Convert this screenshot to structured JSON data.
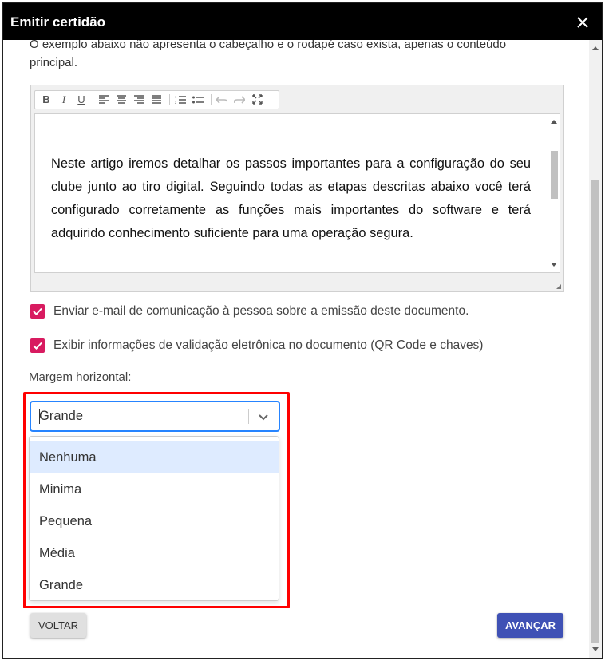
{
  "dialog": {
    "title": "Emitir certidão",
    "intro_line1": "O exemplo abaixo não apresenta o cabeçalho e o rodapé caso exista, apenas o conteúdo",
    "intro_line2": "principal."
  },
  "editor": {
    "toolbar": [
      "bold-icon",
      "italic-icon",
      "underline-icon",
      "align-left-icon",
      "align-center-icon",
      "align-right-icon",
      "align-justify-icon",
      "numbered-list-icon",
      "bullet-list-icon",
      "undo-icon",
      "redo-icon",
      "fullscreen-icon"
    ],
    "content": "Neste artigo iremos detalhar os passos importantes para a configuração do seu clube junto ao tiro digital. Seguindo todas as etapas descritas abaixo você terá configurado corretamente as funções mais importantes do software e terá adquirido conhecimento suficiente para uma operação segura."
  },
  "options": {
    "send_email": "Enviar e-mail de comunicação à pessoa sobre a emissão deste documento.",
    "show_validation": "Exibir informações de validação eletrônica no documento (QR Code e chaves)"
  },
  "margin": {
    "label": "Margem horizontal:",
    "selected": "Grande",
    "choices": [
      "Nenhuma",
      "Minima",
      "Pequena",
      "Média",
      "Grande"
    ]
  },
  "buttons": {
    "back": "VOLTAR",
    "next": "AVANÇAR"
  },
  "colors": {
    "header": "#000000",
    "checkbox": "#d81b60",
    "primary": "#3f51b5",
    "highlight": "#ff0000",
    "option_active": "#deebff"
  }
}
